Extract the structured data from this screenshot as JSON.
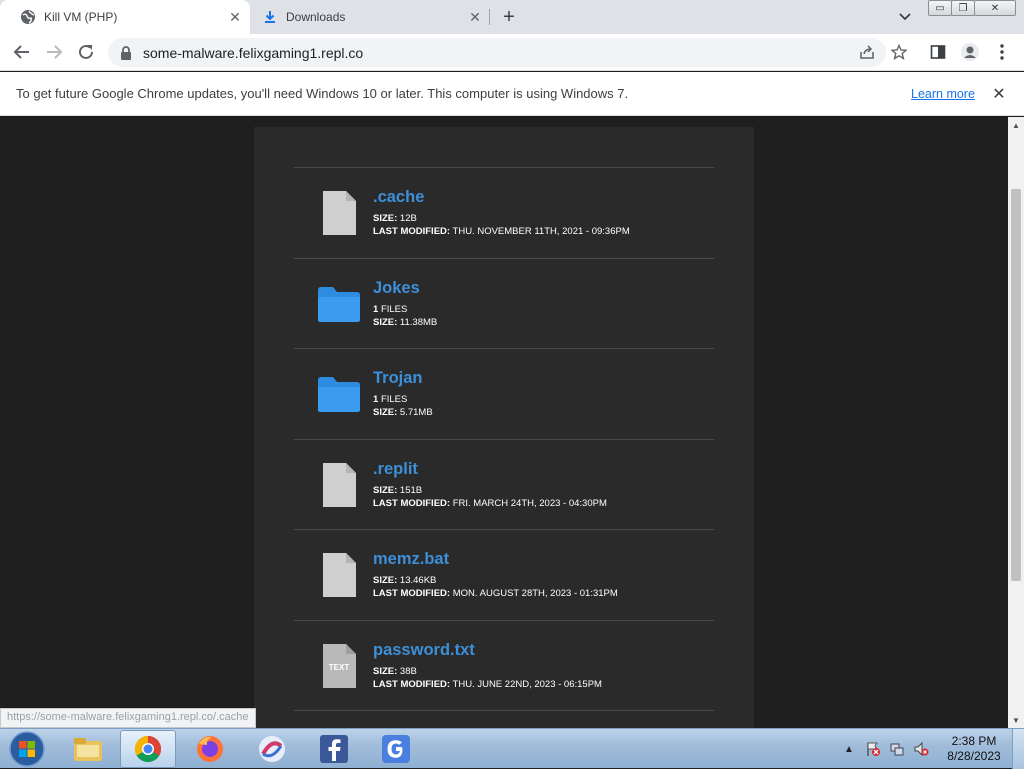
{
  "browser": {
    "tabs": [
      {
        "title": "Kill VM (PHP)",
        "icon": "globe-icon",
        "active": true
      },
      {
        "title": "Downloads",
        "icon": "download-icon",
        "active": false
      }
    ],
    "new_tab": "+",
    "window_controls": {
      "minimize": "▭",
      "restore": "❐",
      "close": "✕"
    },
    "url": "some-malware.felixgaming1.repl.co"
  },
  "infobar": {
    "message": "To get future Google Chrome updates, you'll need Windows 10 or later. This computer is using Windows 7.",
    "link": "Learn more"
  },
  "files": [
    {
      "name": ".cache",
      "type": "file",
      "l1": "SIZE:",
      "v1": "12B",
      "l2": "LAST MODIFIED:",
      "v2": "THU. NOVEMBER 11TH, 2021 - 09:36PM"
    },
    {
      "name": "Jokes",
      "type": "folder",
      "l1": "1",
      "v1": "FILES",
      "l2": "SIZE:",
      "v2": "11.38MB"
    },
    {
      "name": "Trojan",
      "type": "folder",
      "l1": "1",
      "v1": "FILES",
      "l2": "SIZE:",
      "v2": "5.71MB"
    },
    {
      "name": ".replit",
      "type": "file",
      "l1": "SIZE:",
      "v1": "151B",
      "l2": "LAST MODIFIED:",
      "v2": "FRI. MARCH 24TH, 2023 - 04:30PM"
    },
    {
      "name": "memz.bat",
      "type": "file",
      "l1": "SIZE:",
      "v1": "13.46KB",
      "l2": "LAST MODIFIED:",
      "v2": "MON. AUGUST 28TH, 2023 - 01:31PM"
    },
    {
      "name": "password.txt",
      "type": "text",
      "icon_label": "TEXT",
      "l1": "SIZE:",
      "v1": "38B",
      "l2": "LAST MODIFIED:",
      "v2": "THU. JUNE 22ND, 2023 - 06:15PM"
    }
  ],
  "status_url": "https://some-malware.felixgaming1.repl.co/.cache",
  "taskbar": {
    "apps": [
      "explorer-icon",
      "chrome-icon",
      "firefox-icon",
      "browser-icon",
      "facebook-icon",
      "google-icon"
    ],
    "time": "2:38 PM",
    "date": "8/28/2023"
  },
  "colors": {
    "link_blue": "#3d8fd8",
    "folder_blue": "#2e8ce0",
    "file_gray": "#cfcfcf"
  }
}
